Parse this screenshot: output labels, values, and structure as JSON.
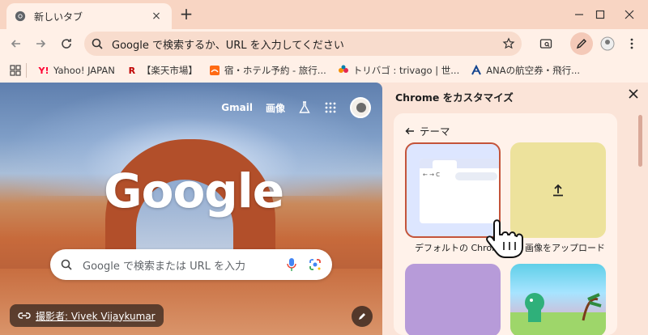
{
  "tab": {
    "title": "新しいタブ",
    "close": "×",
    "new_tab": "+"
  },
  "toolbar": {
    "omnibox_text": "Google で検索するか、URL を入力してください"
  },
  "bookmarks": [
    {
      "label": "Yahoo! JAPAN",
      "icon": "yahoo-icon",
      "icon_text": "Y!",
      "color": "#ff0033"
    },
    {
      "label": "【楽天市場】",
      "icon": "rakuten-icon",
      "icon_text": "R",
      "color": "#bf0000"
    },
    {
      "label": "宿・ホテル予約 - 旅行...",
      "icon": "jalan-icon",
      "icon_text": "",
      "color": "#ff6a13"
    },
    {
      "label": "トリバゴ : trivago | 世...",
      "icon": "trivago-icon",
      "icon_text": "",
      "color": "#e32851"
    },
    {
      "label": "ANAの航空券・飛行...",
      "icon": "ana-icon",
      "icon_text": "",
      "color": "#13448f"
    }
  ],
  "ntp": {
    "gmail": "Gmail",
    "images": "画像",
    "logo": "Google",
    "search_placeholder": "Google で検索または URL を入力",
    "photo_credit": "撮影者: Vivek Vijaykumar"
  },
  "panel": {
    "title": "Chrome をカスタマイズ",
    "back_label": "テーマ",
    "themes": [
      {
        "label": "デフォルトの Chrome",
        "selected": true
      },
      {
        "label": "画像をアップロード",
        "selected": false
      }
    ]
  },
  "colors": {
    "tabstrip": "#f8d5c3",
    "toolbar": "#fff0e7",
    "selected_border": "#c4543a"
  }
}
